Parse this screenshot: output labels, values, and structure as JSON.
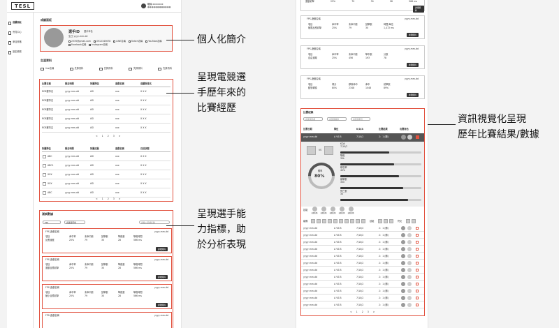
{
  "logo": "TESL",
  "user": {
    "name": "暱稱 xxxxxxxx",
    "email": "●●●●●●●●●●●●"
  },
  "sidebar": [
    {
      "label": "成績面板"
    },
    {
      "label": "會員中心"
    },
    {
      "label": "參加資格"
    },
    {
      "label": "設定帳號"
    }
  ],
  "left": {
    "page_title": "成績面板",
    "profile": {
      "player_id": "選手ID",
      "real_name": "選手本名",
      "birth": "生日  yyyy-mm-dd",
      "contacts": [
        "2335@gmail.com",
        "0912345678",
        "LINE名稱",
        "Twitch名稱",
        "YouTube名稱",
        "Facebook名稱",
        "Instagram名稱"
      ]
    },
    "basic_title": "生涯資料",
    "tabs": [
      "line名稱",
      "先鋒資料",
      "先鋒資料",
      "先鋒資料",
      "先鋒資料"
    ],
    "table1": {
      "headers": [
        "比賽名稱",
        "報名時間",
        "所屬隊伍",
        "遊戲名稱",
        "成績與排名"
      ],
      "rows": [
        [
          "RCB賽事名",
          "yyyy-mm-dd",
          "ASI",
          "xxx",
          "X X X"
        ],
        [
          "RCB賽事名",
          "yyyy-mm-dd",
          "ASI",
          "xxx",
          "X X X"
        ],
        [
          "RCB賽事名",
          "yyyy-mm-dd",
          "ASI",
          "xxx",
          "X X X"
        ],
        [
          "RCB賽事名",
          "yyyy-mm-dd",
          "ASI",
          "xxx",
          "X X X"
        ],
        [
          "RCB賽事名",
          "yyyy-mm-dd",
          "ASI",
          "xxx",
          "X X X"
        ]
      ],
      "pager": [
        "<",
        "1",
        "2",
        "3",
        ">"
      ]
    },
    "table2": {
      "headers": [
        "所屬隊伍",
        "報名時間",
        "所屬成員",
        "遊戲名稱",
        "目前狀態"
      ],
      "rows": [
        [
          "ABC",
          "yyyy-mm-dd",
          "ASI",
          "xxx",
          "X X X"
        ],
        [
          "ABC1",
          "yyyy-mm-dd",
          "ASI",
          "xxx",
          "X X X"
        ],
        [
          "XXX",
          "yyyy-mm-dd",
          "ASI",
          "xxx",
          "X X X"
        ],
        [
          "XXX",
          "yyyy-mm-dd",
          "ASI",
          "xxx",
          "X X X"
        ],
        [
          "ABC",
          "yyyy-mm-dd",
          "ASI",
          "xxx",
          "X X X"
        ]
      ],
      "pager": [
        "<",
        "1",
        "2",
        "3",
        ">"
      ]
    },
    "analysis": {
      "title": "測試數據",
      "filter1": "FPS",
      "filter2": "請選擇年份",
      "search": "請輸入遊戲名稱",
      "cards": [
        {
          "game": "FPS-遊戲名稱",
          "date": "yyyy-mm-dd",
          "labels": [
            "項目",
            "命中率",
            "未命中數",
            "回擊數",
            "擊殺數",
            "擊殺時間"
          ],
          "values": [
            "反應速度",
            "25%",
            "79",
            "30",
            "28",
            "566 ms"
          ],
          "btn": "詳細資料"
        },
        {
          "game": "FPS-遊戲名稱",
          "date": "yyyy-mm-dd",
          "labels": [
            "項目",
            "命中率",
            "未命中數",
            "回擊數",
            "擊殺數",
            "擊殺時間"
          ],
          "values": [
            "運動目標射擊",
            "25%",
            "79",
            "30",
            "28",
            "566 ms"
          ],
          "btn": "詳細資料"
        },
        {
          "game": "FPS-遊戲名稱",
          "date": "yyyy-mm-dd",
          "labels": [
            "項目",
            "命中率",
            "未命中數",
            "回擊數",
            "擊殺數",
            "擊殺時間"
          ],
          "values": [
            "極小目標射擊",
            "25%",
            "79",
            "30",
            "28",
            "566 ms"
          ],
          "btn": "詳細資料"
        },
        {
          "game": "FPS-遊戲名稱",
          "date": "yyyy-mm-dd",
          "labels": [
            "",
            "",
            "",
            "",
            "",
            ""
          ],
          "values": [
            "",
            "",
            "",
            "",
            "",
            ""
          ],
          "btn": ""
        }
      ]
    }
  },
  "right": {
    "top_row": [
      "運動射擊",
      "25%",
      "79",
      "30",
      "28",
      "566 ms"
    ],
    "top_btn": "詳細資料",
    "cards": [
      {
        "game": "FPS-遊戲名稱",
        "date": "yyyy-mm-dd",
        "labels": [
          "項目",
          "命中率",
          "未命中數",
          "回擊數",
          "時間/單位"
        ],
        "values": [
          "極限反應射擊",
          "25%",
          "79",
          "30",
          "1,472 ms"
        ],
        "btn": "詳細資料"
      },
      {
        "game": "FPS-遊戲名稱",
        "date": "yyyy-mm-dd",
        "labels": [
          "項目",
          "命中率",
          "未命中數",
          "擊中數",
          "分數"
        ],
        "values": [
          "自由追蹤",
          "25%",
          "456",
          "193",
          "78"
        ],
        "btn": "詳細資料"
      },
      {
        "game": "FPS-遊戲名稱",
        "date": "yyyy-mm-dd",
        "labels": [
          "項目",
          "得分",
          "移除命中",
          "命中",
          "射擊數"
        ],
        "values": [
          "動態轉換",
          "80%",
          "2348",
          "1048",
          "89%"
        ],
        "btn": "詳細資料"
      }
    ],
    "results": {
      "title": "比賽紀錄",
      "filters": [
        "請選擇遊戲",
        "請選擇賽季",
        "請選擇年份"
      ],
      "headers": [
        "比賽日期",
        "隊伍",
        "K/D/A",
        "比賽結果",
        "出賽角色"
      ],
      "first_row": [
        "yyyy-mm-dd",
        "A VS B",
        "7/10/2",
        "2：1 (勝)"
      ],
      "vs": "VS",
      "winrate_label": "勝率",
      "winrate_value": "80%",
      "stats": [
        {
          "label": "KDA",
          "value": "7/10/2"
        },
        {
          "label": "擊殺",
          "value": "30k"
        },
        {
          "label": "助攻率",
          "value": "40%"
        },
        {
          "label": "總擊數",
          "value": "300"
        },
        {
          "label": "死亡數",
          "value": "30"
        }
      ],
      "skill_label": "技能",
      "skill_items": [
        "技能名稱",
        "技能名稱",
        "技能名稱",
        "技能名稱",
        "技能名稱"
      ],
      "item_label": "裝備",
      "extra_label": "技能",
      "extra_label2": "符文",
      "rows": [
        [
          "yyyy-mm-dd",
          "A VS B",
          "7/10/2",
          "2：1 (勝)"
        ],
        [
          "yyyy-mm-dd",
          "A VS B",
          "7/10/2",
          "2：1 (勝)"
        ],
        [
          "yyyy-mm-dd",
          "A VS B",
          "7/10/2",
          "2：1 (勝)"
        ],
        [
          "yyyy-mm-dd",
          "A VS B",
          "7/10/2",
          "2：1 (勝)"
        ],
        [
          "yyyy-mm-dd",
          "A VS B",
          "7/10/2",
          "2：1 (勝)"
        ],
        [
          "yyyy-mm-dd",
          "A VS B",
          "7/10/2",
          "2：1 (勝)"
        ],
        [
          "yyyy-mm-dd",
          "A VS B",
          "7/10/2",
          "2：1 (勝)"
        ],
        [
          "yyyy-mm-dd",
          "A VS B",
          "7/10/2",
          "2：1 (勝)"
        ],
        [
          "yyyy-mm-dd",
          "A VS B",
          "7/10/2",
          "2：1 (勝)"
        ],
        [
          "yyyy-mm-dd",
          "A VS B",
          "7/10/2",
          "2：1 (勝)"
        ],
        [
          "yyyy-mm-dd",
          "A VS B",
          "7/10/2",
          "2：1 (勝)"
        ],
        [
          "yyyy-mm-dd",
          "A VS B",
          "7/10/2",
          "2：1 (勝)"
        ]
      ],
      "pager": [
        "<",
        "1",
        "2",
        "3",
        ">"
      ]
    }
  },
  "annotations": {
    "profile": "個人化簡介",
    "history": [
      "呈現電競選",
      "手歷年來的",
      "比賽經歷"
    ],
    "ability": [
      "呈現選手能",
      "力指標，助",
      "於分析表現"
    ],
    "visual": [
      "資訊視覺化呈現",
      "歷年比賽結果/數據"
    ]
  },
  "colors": {
    "accent": "#e2523f",
    "dark": "#333333"
  }
}
